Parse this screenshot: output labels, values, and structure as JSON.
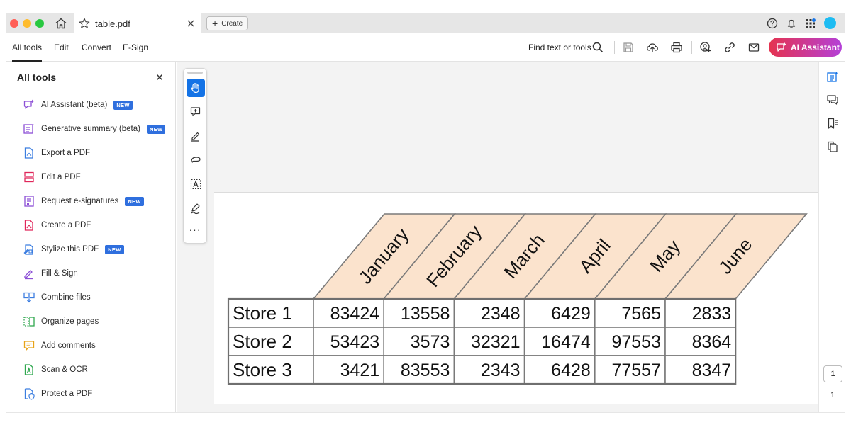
{
  "tab": {
    "title": "table.pdf"
  },
  "titlebar": {
    "create_label": "Create"
  },
  "menu": {
    "items": [
      "All tools",
      "Edit",
      "Convert",
      "E-Sign"
    ],
    "active": "All tools"
  },
  "toolbar": {
    "find_label": "Find text or tools",
    "ai_assistant_label": "AI Assistant"
  },
  "tools_panel": {
    "title": "All tools",
    "items": [
      {
        "label": "AI Assistant (beta)",
        "badge": "NEW",
        "icon": "ai-assistant-icon",
        "color": "#8c4fd6"
      },
      {
        "label": "Generative summary (beta)",
        "badge": "NEW",
        "icon": "generative-summary-icon",
        "color": "#8c4fd6"
      },
      {
        "label": "Export a PDF",
        "badge": "",
        "icon": "export-pdf-icon",
        "color": "#3b7de0"
      },
      {
        "label": "Edit a PDF",
        "badge": "",
        "icon": "edit-pdf-icon",
        "color": "#e0265a"
      },
      {
        "label": "Request e-signatures",
        "badge": "NEW",
        "icon": "request-esign-icon",
        "color": "#8c4fd6"
      },
      {
        "label": "Create a PDF",
        "badge": "",
        "icon": "create-pdf-icon",
        "color": "#e0265a"
      },
      {
        "label": "Stylize this PDF",
        "badge": "NEW",
        "icon": "stylize-pdf-icon",
        "color": "#3b7de0"
      },
      {
        "label": "Fill & Sign",
        "badge": "",
        "icon": "fill-sign-icon",
        "color": "#8c4fd6"
      },
      {
        "label": "Combine files",
        "badge": "",
        "icon": "combine-files-icon",
        "color": "#3b7de0"
      },
      {
        "label": "Organize pages",
        "badge": "",
        "icon": "organize-pages-icon",
        "color": "#2fa84f"
      },
      {
        "label": "Add comments",
        "badge": "",
        "icon": "add-comments-icon",
        "color": "#e8a317"
      },
      {
        "label": "Scan & OCR",
        "badge": "",
        "icon": "scan-ocr-icon",
        "color": "#2fa84f"
      },
      {
        "label": "Protect a PDF",
        "badge": "",
        "icon": "protect-pdf-icon",
        "color": "#3b7de0"
      }
    ]
  },
  "document": {
    "table": {
      "months": [
        "January",
        "February",
        "March",
        "April",
        "May",
        "June"
      ],
      "header_color": "#fbe3cd",
      "rows": [
        {
          "store": "Store 1",
          "values": [
            "83424",
            "13558",
            "2348",
            "6429",
            "7565",
            "2833"
          ]
        },
        {
          "store": "Store 2",
          "values": [
            "53423",
            "3573",
            "32321",
            "16474",
            "97553",
            "8364"
          ]
        },
        {
          "store": "Store 3",
          "values": [
            "3421",
            "83553",
            "2343",
            "6428",
            "77557",
            "8347"
          ]
        }
      ]
    }
  },
  "page_nav": {
    "current": "1",
    "total": "1"
  }
}
